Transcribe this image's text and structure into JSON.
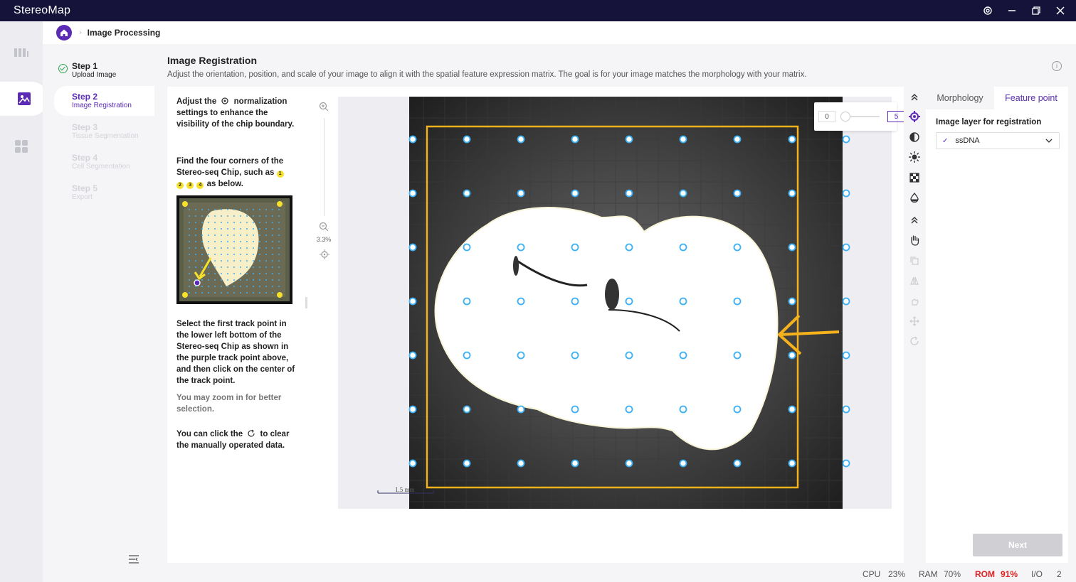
{
  "app": {
    "title": "StereoMap"
  },
  "breadcrumb": {
    "current": "Image Processing"
  },
  "steps": [
    {
      "title": "Step 1",
      "subtitle": "Upload Image",
      "state": "done"
    },
    {
      "title": "Step 2",
      "subtitle": "Image Registration",
      "state": "active"
    },
    {
      "title": "Step 3",
      "subtitle": "Tissue Segmentation",
      "state": "disabled"
    },
    {
      "title": "Step 4",
      "subtitle": "Cell Segmentation",
      "state": "disabled"
    },
    {
      "title": "Step 5",
      "subtitle": "Export",
      "state": "disabled"
    }
  ],
  "header": {
    "title": "Image Registration",
    "description": "Adjust the orientation, position, and scale of your image to align it with the spatial feature expression matrix. The goal is for your image matches the morphology with your matrix."
  },
  "instructions": {
    "p1_a": "Adjust the",
    "p1_b": "normalization settings to enhance the visibility of the chip boundary.",
    "p2_a": "Find the four corners of the Stereo-seq Chip, such as",
    "p2_b": "as below.",
    "badges": [
      "1",
      "2",
      "3",
      "4"
    ],
    "p3": "Select the first track point in the lower left bottom of the Stereo-seq Chip as shown in the purple track point above, and then click on the center of the track point.",
    "p4": "You may zoom in for better selection.",
    "p5_a": "You can click the",
    "p5_b": "to clear the manually operated data."
  },
  "viewer": {
    "zoom_level": "3.3%",
    "scale_bar": "1.5 mm",
    "slider": {
      "min": "0",
      "max": "5"
    }
  },
  "right_panel": {
    "tabs": [
      "Morphology",
      "Feature point"
    ],
    "active_tab": "Feature point",
    "layer_label": "Image layer for registration",
    "layer_value": "ssDNA"
  },
  "footer": {
    "next_label": "Next"
  },
  "status": {
    "cpu_label": "CPU",
    "cpu_value": "23%",
    "ram_label": "RAM",
    "ram_value": "70%",
    "rom_label": "ROM",
    "rom_value": "91%",
    "io_label": "I/O",
    "io_value": "2"
  },
  "colors": {
    "accent": "#5b2bb5",
    "titlebar": "#16133a",
    "chip_frame": "#f5b21c",
    "track_point": "#3ab0f5",
    "rom_alert": "#e02020",
    "done": "#2fa84f"
  }
}
